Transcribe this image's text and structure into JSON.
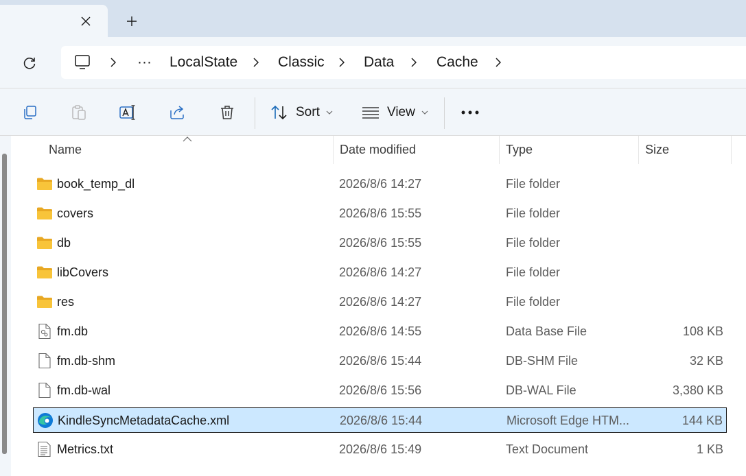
{
  "tabs": {
    "close_glyph": "✕",
    "new_glyph": "+"
  },
  "breadcrumb": {
    "overflow": "···",
    "items": [
      "LocalState",
      "Classic",
      "Data",
      "Cache"
    ]
  },
  "toolbar": {
    "sort_label": "Sort",
    "view_label": "View",
    "more_glyph": "···"
  },
  "columns": {
    "name": "Name",
    "date": "Date modified",
    "type": "Type",
    "size": "Size"
  },
  "files": [
    {
      "name": "book_temp_dl",
      "date": "2026/8/6 14:27",
      "type": "File folder",
      "size": "",
      "icon": "folder-icon"
    },
    {
      "name": "covers",
      "date": "2026/8/6 15:55",
      "type": "File folder",
      "size": "",
      "icon": "folder-icon"
    },
    {
      "name": "db",
      "date": "2026/8/6 15:55",
      "type": "File folder",
      "size": "",
      "icon": "folder-icon"
    },
    {
      "name": "libCovers",
      "date": "2026/8/6 14:27",
      "type": "File folder",
      "size": "",
      "icon": "folder-icon"
    },
    {
      "name": "res",
      "date": "2026/8/6 14:27",
      "type": "File folder",
      "size": "",
      "icon": "folder-icon"
    },
    {
      "name": "fm.db",
      "date": "2026/8/6 14:55",
      "type": "Data Base File",
      "size": "108 KB",
      "icon": "database-file-icon"
    },
    {
      "name": "fm.db-shm",
      "date": "2026/8/6 15:44",
      "type": "DB-SHM File",
      "size": "32 KB",
      "icon": "blank-file-icon"
    },
    {
      "name": "fm.db-wal",
      "date": "2026/8/6 15:56",
      "type": "DB-WAL File",
      "size": "3,380 KB",
      "icon": "blank-file-icon"
    },
    {
      "name": "KindleSyncMetadataCache.xml",
      "date": "2026/8/6 15:44",
      "type": "Microsoft Edge HTM...",
      "size": "144 KB",
      "icon": "edge-icon",
      "selected": true
    },
    {
      "name": "Metrics.txt",
      "date": "2026/8/6 15:49",
      "type": "Text Document",
      "size": "1 KB",
      "icon": "text-file-icon"
    }
  ],
  "colors": {
    "accent_selected": "#cce8ff",
    "folder": "#f8c43a",
    "chrome": "#f2f6fa",
    "tabstrip": "#d6e1ee"
  }
}
